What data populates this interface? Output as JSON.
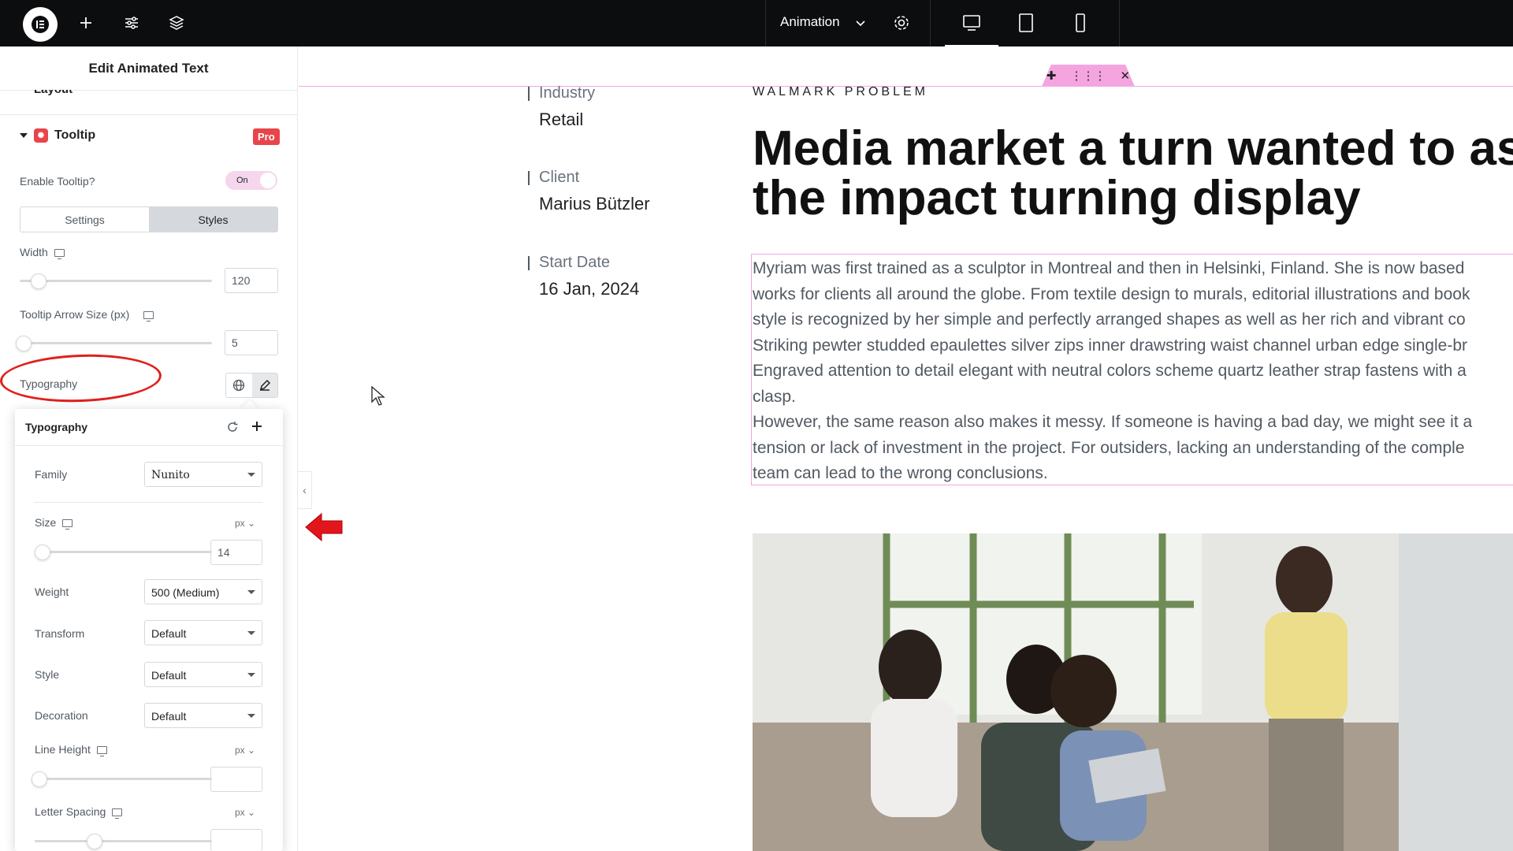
{
  "topbar": {
    "animation_label": "Animation",
    "icons": [
      "elementor-logo-icon",
      "add-icon",
      "settings-sliders-icon",
      "layers-icon",
      "chevron-down-icon",
      "gear-icon",
      "desktop-icon",
      "tablet-icon",
      "mobile-icon"
    ]
  },
  "panel": {
    "title": "Edit Animated Text",
    "prev_section": "Layout",
    "tooltip": {
      "title": "Tooltip",
      "pro_badge": "Pro",
      "enable_label": "Enable Tooltip?",
      "enable_value": "On",
      "tabs": [
        "Settings",
        "Styles"
      ],
      "active_tab": "Styles",
      "width_label": "Width",
      "width_value": "120",
      "width_fraction": 0.1,
      "arrow_label": "Tooltip Arrow Size (px)",
      "arrow_value": "5",
      "arrow_fraction": 0.02,
      "typography_label": "Typography"
    }
  },
  "typography_popover": {
    "title": "Typography",
    "family_label": "Family",
    "family_value": "Nunito",
    "size_label": "Size",
    "size_unit": "px",
    "size_value": "14",
    "weight_label": "Weight",
    "weight_value": "500 (Medium)",
    "transform_label": "Transform",
    "transform_value": "Default",
    "style_label": "Style",
    "style_value": "Default",
    "decoration_label": "Decoration",
    "decoration_value": "Default",
    "line_height_label": "Line Height",
    "line_height_unit": "px",
    "line_height_value": "",
    "letter_spacing_label": "Letter Spacing",
    "letter_spacing_unit": "px",
    "letter_spacing_value": ""
  },
  "canvas": {
    "meta": [
      {
        "label": "Industry",
        "value": "Retail"
      },
      {
        "label": "Client",
        "value": "Marius Bützler"
      },
      {
        "label": "Start Date",
        "value": "16 Jan, 2024"
      }
    ],
    "kicker": "WALMARK PROBLEM",
    "headline_line1": "Media market a turn wanted to as",
    "headline_line2": "the impact turning display",
    "paragraph_lines": [
      "Myriam was first trained as a sculptor in Montreal and then in Helsinki, Finland. She is now based",
      "works for clients all around the globe. From textile design to murals, editorial illustrations and book",
      "style is recognized by her simple and perfectly arranged shapes as well as her rich and vibrant co",
      "Striking pewter studded epaulettes silver zips inner drawstring waist channel urban edge single-br",
      "Engraved attention to detail elegant with neutral colors scheme quartz leather strap fastens with a",
      "clasp.",
      "However, the same reason also makes it messy. If someone is having a bad day, we might see it a",
      "tension or lack of investment in the project. For outsiders, lacking an understanding of the comple",
      "team can lead to the wrong conclusions."
    ]
  }
}
